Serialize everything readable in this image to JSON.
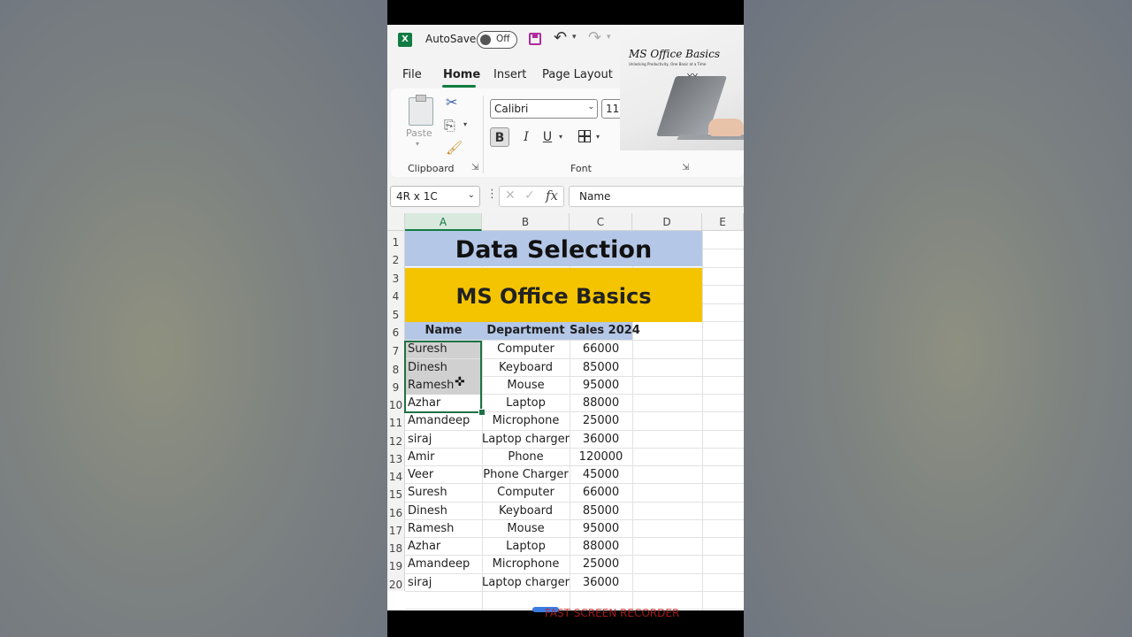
{
  "titlebar": {
    "logo_letter": "X",
    "autosave_label": "AutoSave",
    "toggle_state": "Off"
  },
  "tabs": [
    "File",
    "Home",
    "Insert",
    "Page Layout"
  ],
  "active_tab": "Home",
  "ribbon": {
    "paste_label": "Paste",
    "clipboard_label": "Clipboard",
    "font_name": "Calibri",
    "font_size": "11",
    "font_label": "Font",
    "bold": "B",
    "italic": "I",
    "underline": "U"
  },
  "overlay": {
    "title": "MS Office Basics",
    "tagline": "Unlocking Productivity, One Basic at a Time"
  },
  "formula_bar": {
    "name_box": "4R x 1C",
    "fx": "fx",
    "content": "Name"
  },
  "columns": [
    "A",
    "B",
    "C",
    "D",
    "E"
  ],
  "rows": [
    "1",
    "2",
    "3",
    "4",
    "5",
    "6",
    "7",
    "8",
    "9",
    "10",
    "11",
    "12",
    "13",
    "14",
    "15",
    "16",
    "17",
    "18",
    "19",
    "20"
  ],
  "sheet": {
    "title1": "Data Selection",
    "title2": "MS Office Basics",
    "headers": [
      "Name",
      "Department",
      "Sales 2024"
    ],
    "data": [
      [
        "Suresh",
        "Computer",
        "66000"
      ],
      [
        "Dinesh",
        "Keyboard",
        "85000"
      ],
      [
        "Ramesh",
        "Mouse",
        "95000"
      ],
      [
        "Azhar",
        "Laptop",
        "88000"
      ],
      [
        "Amandeep",
        "Microphone",
        "25000"
      ],
      [
        "siraj",
        "Laptop charger",
        "36000"
      ],
      [
        "Amir",
        "Phone",
        "120000"
      ],
      [
        "Veer",
        "Phone Charger",
        "45000"
      ],
      [
        "Suresh",
        "Computer",
        "66000"
      ],
      [
        "Dinesh",
        "Keyboard",
        "85000"
      ],
      [
        "Ramesh",
        "Mouse",
        "95000"
      ],
      [
        "Azhar",
        "Laptop",
        "88000"
      ],
      [
        "Amandeep",
        "Microphone",
        "25000"
      ],
      [
        "siraj",
        "Laptop charger",
        "36000"
      ]
    ]
  },
  "watermark": "FAST SCREEN RECORDER",
  "colors": {
    "excel_green": "#107c41",
    "header_blue": "#b4c7e7",
    "title_gold": "#f5c400",
    "selection_gray": "#d0d0d0"
  }
}
